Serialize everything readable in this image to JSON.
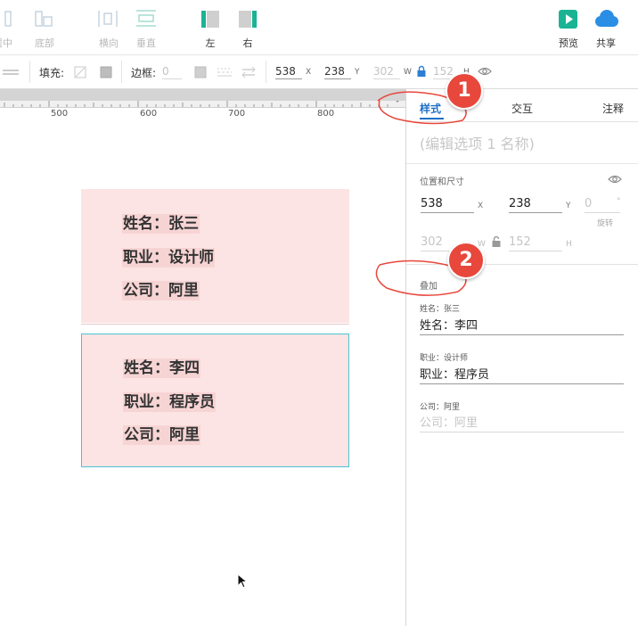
{
  "toolbar": {
    "items": [
      {
        "label": "居中"
      },
      {
        "label": "底部"
      },
      {
        "label": "横向"
      },
      {
        "label": "垂直"
      },
      {
        "label": "左"
      },
      {
        "label": "右"
      },
      {
        "label": "预览"
      },
      {
        "label": "共享"
      }
    ]
  },
  "propbar": {
    "fill_label": "填充:",
    "border_label": "边框:",
    "border_value": "0",
    "x_value": "538",
    "x_unit": "X",
    "y_value": "238",
    "y_unit": "Y",
    "w_value": "302",
    "w_unit": "W",
    "h_value": "152",
    "h_unit": "H"
  },
  "ruler": {
    "labels": [
      "500",
      "600",
      "700",
      "800"
    ]
  },
  "cards": [
    {
      "lines": [
        "姓名：张三",
        "职业：设计师",
        "公司：阿里"
      ]
    },
    {
      "lines": [
        "姓名：李四",
        "职业：程序员",
        "公司：阿里"
      ]
    }
  ],
  "panel": {
    "tabs": [
      "样式",
      "交互",
      "注释"
    ],
    "title_placeholder": "(编辑选项 1 名称)",
    "position_section": "位置和尺寸",
    "x_value": "538",
    "x_unit": "X",
    "y_value": "238",
    "y_unit": "Y",
    "rotation_value": "0",
    "rotation_unit": "°",
    "rotation_label": "旋转",
    "w_value": "302",
    "w_unit": "W",
    "h_value": "152",
    "h_unit": "H",
    "overlay_section": "叠加",
    "fields": [
      {
        "label": "姓名：张三",
        "value": "姓名：李四",
        "placeholder": ""
      },
      {
        "label": "职业：设计师",
        "value": "职业：程序员",
        "placeholder": ""
      },
      {
        "label": "公司：阿里",
        "value": "",
        "placeholder": "公司：阿里"
      }
    ]
  },
  "annotations": {
    "marker1": "1",
    "marker2": "2"
  },
  "colors": {
    "accent": "#1e6fc7",
    "marker": "#e8473c",
    "card_bg": "#fce4e4",
    "preview_green": "#1ab394",
    "cloud_blue": "#2a8ee4",
    "selection": "#4cc3d3"
  }
}
